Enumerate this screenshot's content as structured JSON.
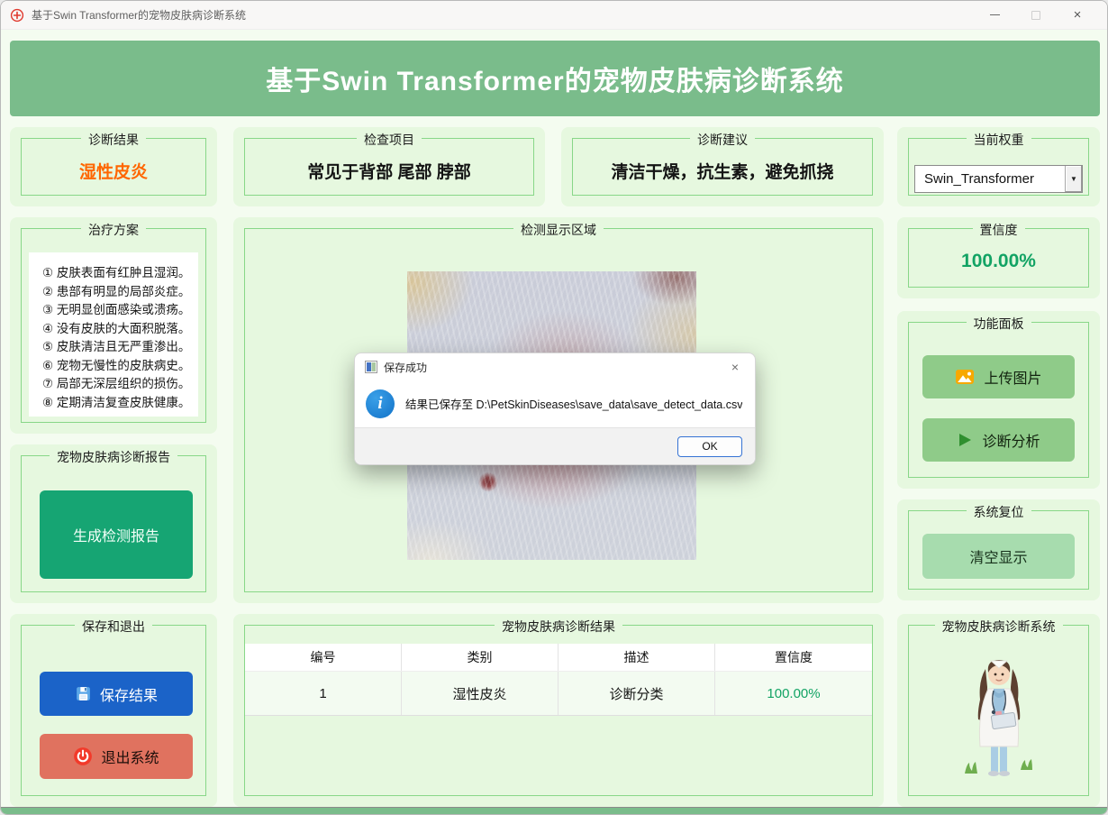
{
  "window": {
    "title": "基于Swin Transformer的宠物皮肤病诊断系统",
    "close_glyph": "×"
  },
  "header": {
    "title": "基于Swin Transformer的宠物皮肤病诊断系统"
  },
  "panels": {
    "diagnosis_result": {
      "title": "诊断结果",
      "value": "湿性皮炎"
    },
    "check_items": {
      "title": "检查项目",
      "value": "常见于背部 尾部 脖部"
    },
    "advice": {
      "title": "诊断建议",
      "value": "清洁干燥，抗生素，避免抓挠"
    },
    "weights": {
      "title": "当前权重",
      "selected": "Swin_Transformer",
      "arrow_glyph": "▼"
    },
    "treatment": {
      "title": "治疗方案",
      "items": [
        "① 皮肤表面有红肿且湿润。",
        "② 患部有明显的局部炎症。",
        "③ 无明显创面感染或溃疡。",
        "④ 没有皮肤的大面积脱落。",
        "⑤ 皮肤清洁且无严重渗出。",
        "⑥ 宠物无慢性的皮肤病史。",
        "⑦ 局部无深层组织的损伤。",
        "⑧ 定期清洁复查皮肤健康。"
      ]
    },
    "display": {
      "title": "检测显示区域"
    },
    "confidence": {
      "title": "置信度",
      "value": "100.00%"
    },
    "functions": {
      "title": "功能面板",
      "upload_label": "上传图片",
      "analyze_label": "诊断分析"
    },
    "reset": {
      "title": "系统复位",
      "clear_label": "清空显示"
    },
    "report": {
      "title": "宠物皮肤病诊断报告",
      "generate_label": "生成检测报告"
    },
    "save_exit": {
      "title": "保存和退出",
      "save_label": "保存结果",
      "exit_label": "退出系统"
    },
    "results": {
      "title": "宠物皮肤病诊断结果",
      "columns": [
        "编号",
        "类别",
        "描述",
        "置信度"
      ],
      "rows": [
        {
          "id": "1",
          "category": "湿性皮炎",
          "description": "诊断分类",
          "confidence": "100.00%"
        }
      ]
    },
    "mascot": {
      "title": "宠物皮肤病诊断系统"
    }
  },
  "dialog": {
    "title": "保存成功",
    "message": "结果已保存至 D:\\PetSkinDiseases\\save_data\\save_detect_data.csv",
    "ok_label": "OK",
    "close_glyph": "×"
  },
  "colors": {
    "header_green": "#7abc8b",
    "panel_green": "#e6f8df",
    "groupbox_border": "#88d788",
    "result_orange": "#ff6600",
    "confidence_green": "#12a364",
    "function_button_green": "#8fcb89",
    "report_button_teal": "#16a573",
    "save_button_blue": "#1b63c8",
    "exit_button_salmon": "#e0725f"
  }
}
